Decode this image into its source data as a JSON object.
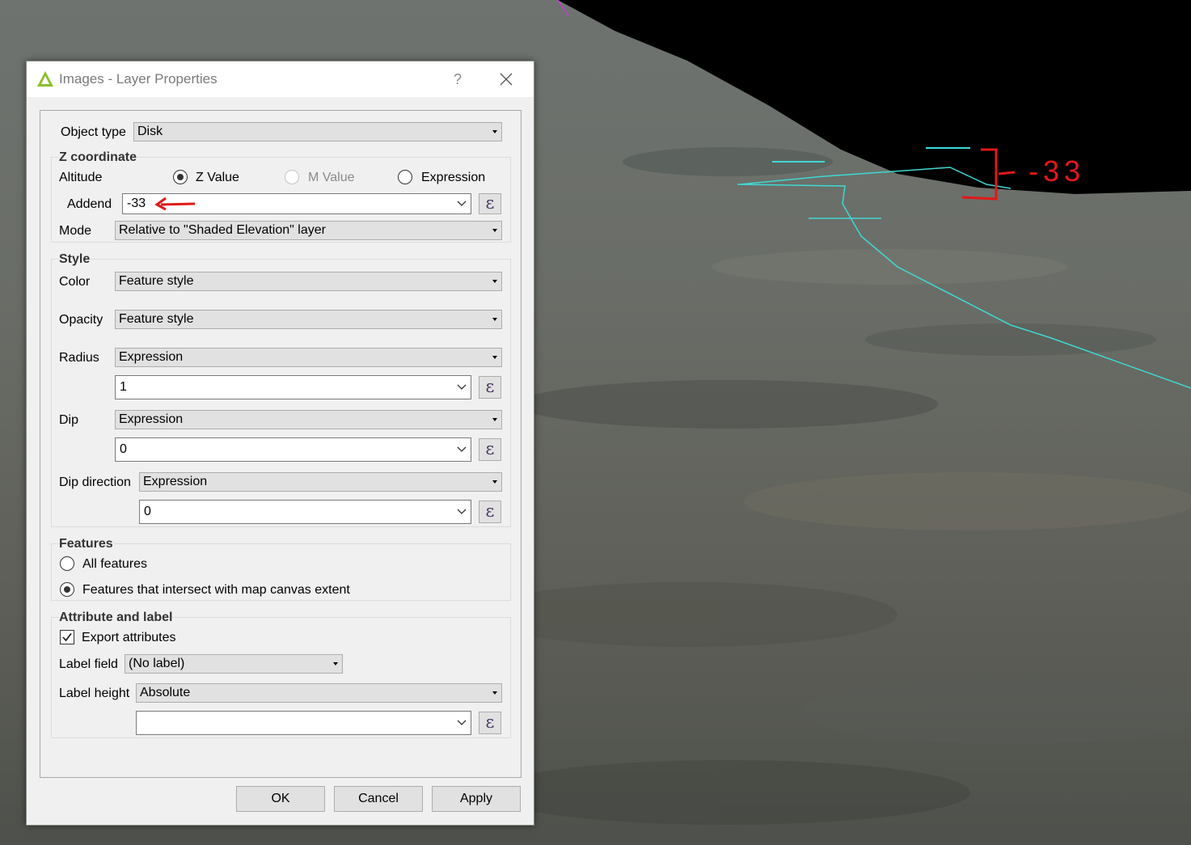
{
  "window": {
    "title": "Images - Layer Properties",
    "help": "?",
    "app_icon": "qgis-icon",
    "close_icon": "close-icon"
  },
  "object_type": {
    "label": "Object type",
    "value": "Disk"
  },
  "z_coordinate": {
    "title": "Z coordinate",
    "altitude_label": "Altitude",
    "options": {
      "z_value": "Z Value",
      "m_value": "M Value",
      "expression": "Expression"
    },
    "selected": "Z Value",
    "addend_label": "Addend",
    "addend_value": "-33",
    "mode_label": "Mode",
    "mode_value": "Relative to \"Shaded Elevation\" layer"
  },
  "style": {
    "title": "Style",
    "color_label": "Color",
    "color_value": "Feature style",
    "opacity_label": "Opacity",
    "opacity_value": "Feature style",
    "radius_label": "Radius",
    "radius_mode": "Expression",
    "radius_value": "1",
    "dip_label": "Dip",
    "dip_mode": "Expression",
    "dip_value": "0",
    "dip_direction_label": "Dip direction",
    "dip_direction_mode": "Expression",
    "dip_direction_value": "0"
  },
  "features": {
    "title": "Features",
    "all_features": "All features",
    "intersect": "Features that intersect with map canvas extent",
    "selected": "Features that intersect with map canvas extent"
  },
  "attribute_label": {
    "title": "Attribute and label",
    "export_attributes": "Export attributes",
    "export_checked": true,
    "label_field_label": "Label field",
    "label_field_value": "(No label)",
    "label_height_label": "Label height",
    "label_height_mode": "Absolute",
    "label_height_value": ""
  },
  "buttons": {
    "ok": "OK",
    "cancel": "Cancel",
    "apply": "Apply"
  },
  "expression_button_glyph": "ε",
  "annotation": {
    "text": "-33",
    "color": "#e21818"
  },
  "colors": {
    "profile_line": "#3fd9d4",
    "sky": "#000000"
  }
}
